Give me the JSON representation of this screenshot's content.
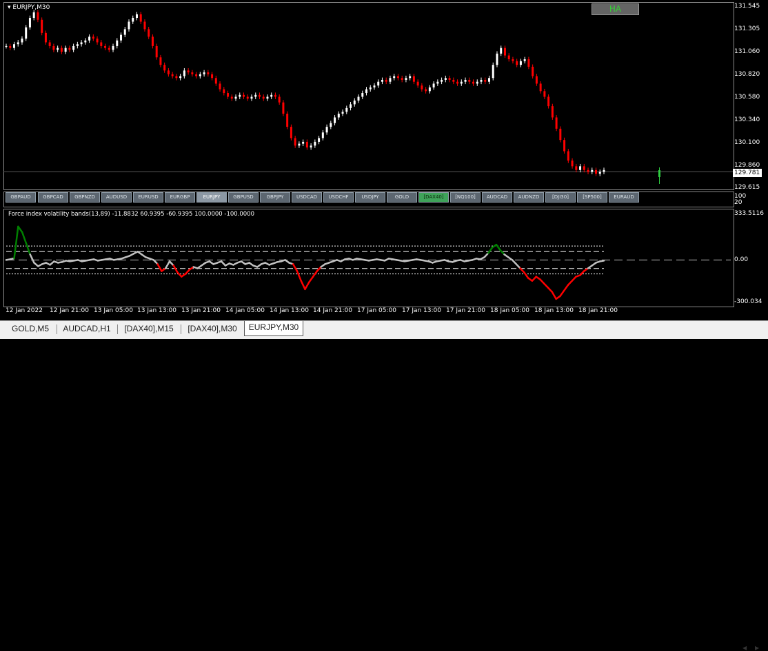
{
  "chart": {
    "title": "EURJPY,M30",
    "indicator_title": "Force index volatility bands(13,89) -11.8832 60.9395 -60.9395 100.0000 -100.0000",
    "ha_label": "HA",
    "price_axis": [
      "131.545",
      "131.305",
      "131.060",
      "130.820",
      "130.580",
      "130.340",
      "130.100",
      "129.860",
      "129.615"
    ],
    "current_price": "129.781",
    "mid_axis": [
      "100",
      "20"
    ],
    "ind_axis": [
      "333.5116",
      "0.00",
      "-300.034"
    ],
    "time_axis": [
      "12 Jan 2022",
      "12 Jan 21:00",
      "13 Jan 05:00",
      "13 Jan 13:00",
      "13 Jan 21:00",
      "14 Jan 05:00",
      "14 Jan 13:00",
      "14 Jan 21:00",
      "17 Jan 05:00",
      "17 Jan 13:00",
      "17 Jan 21:00",
      "18 Jan 05:00",
      "18 Jan 13:00",
      "18 Jan 21:00"
    ],
    "colors": {
      "bull": "#ffffff",
      "bear": "#ff0000",
      "grid": "#8c8c8c",
      "band": "#ffffff",
      "line": "#c0c0c0",
      "up_signal": "#008000",
      "down_signal": "#ff0000"
    }
  },
  "symbol_buttons": [
    {
      "label": "GBPAUD",
      "style": ""
    },
    {
      "label": "GBPCAD",
      "style": ""
    },
    {
      "label": "GBPNZD",
      "style": ""
    },
    {
      "label": "AUDUSD",
      "style": ""
    },
    {
      "label": "EURUSD",
      "style": ""
    },
    {
      "label": "EURGBP",
      "style": ""
    },
    {
      "label": "EURJPY",
      "style": "active"
    },
    {
      "label": "GBPUSD",
      "style": ""
    },
    {
      "label": "GBPJPY",
      "style": ""
    },
    {
      "label": "USDCAD",
      "style": ""
    },
    {
      "label": "USDCHF",
      "style": ""
    },
    {
      "label": "USDJPY",
      "style": ""
    },
    {
      "label": "GOLD",
      "style": ""
    },
    {
      "label": "[DAX40]",
      "style": "green"
    },
    {
      "label": "[NQ100]",
      "style": ""
    },
    {
      "label": "AUDCAD",
      "style": ""
    },
    {
      "label": "AUDNZD",
      "style": ""
    },
    {
      "label": "[DJI30]",
      "style": ""
    },
    {
      "label": "[SP500]",
      "style": ""
    },
    {
      "label": "EURAUD",
      "style": ""
    }
  ],
  "tabs": [
    {
      "label": "GOLD,M5",
      "active": false
    },
    {
      "label": "AUDCAD,H1",
      "active": false
    },
    {
      "label": "[DAX40],M15",
      "active": false
    },
    {
      "label": "[DAX40],M30",
      "active": false
    },
    {
      "label": "EURJPY,M30",
      "active": true
    }
  ],
  "price_series": [
    131.12,
    131.1,
    131.14,
    131.16,
    131.2,
    131.32,
    131.42,
    131.48,
    131.4,
    131.26,
    131.16,
    131.12,
    131.08,
    131.1,
    131.06,
    131.1,
    131.08,
    131.12,
    131.14,
    131.16,
    131.18,
    131.22,
    131.2,
    131.16,
    131.12,
    131.1,
    131.08,
    131.12,
    131.18,
    131.24,
    131.3,
    131.38,
    131.42,
    131.46,
    131.38,
    131.3,
    131.22,
    131.12,
    131.0,
    130.92,
    130.86,
    130.82,
    130.8,
    130.78,
    130.8,
    130.86,
    130.84,
    130.82,
    130.8,
    130.82,
    130.84,
    130.82,
    130.78,
    130.72,
    130.66,
    130.62,
    130.58,
    130.56,
    130.58,
    130.6,
    130.58,
    130.56,
    130.58,
    130.6,
    130.58,
    130.56,
    130.58,
    130.6,
    130.58,
    130.52,
    130.4,
    130.26,
    130.14,
    130.06,
    130.08,
    130.1,
    130.04,
    130.06,
    130.1,
    130.14,
    130.2,
    130.26,
    130.3,
    130.36,
    130.4,
    130.42,
    130.46,
    130.5,
    130.54,
    130.58,
    130.62,
    130.66,
    130.68,
    130.7,
    130.74,
    130.76,
    130.74,
    130.78,
    130.8,
    130.78,
    130.76,
    130.78,
    130.8,
    130.74,
    130.7,
    130.66,
    130.64,
    130.68,
    130.72,
    130.74,
    130.76,
    130.78,
    130.76,
    130.74,
    130.72,
    130.74,
    130.76,
    130.74,
    130.72,
    130.74,
    130.76,
    130.74,
    130.78,
    130.92,
    131.04,
    131.1,
    131.02,
    130.98,
    130.96,
    130.92,
    130.96,
    130.98,
    130.9,
    130.8,
    130.72,
    130.64,
    130.58,
    130.48,
    130.36,
    130.24,
    130.12,
    130.0,
    129.9,
    129.84,
    129.8,
    129.84,
    129.8,
    129.78,
    129.8,
    129.76,
    129.78,
    129.8
  ],
  "ind_series": [
    0,
    5,
    12,
    240,
    200,
    120,
    40,
    -20,
    -45,
    -30,
    -20,
    -35,
    -10,
    -20,
    -15,
    -5,
    -10,
    -5,
    0,
    -10,
    -5,
    0,
    5,
    -5,
    0,
    5,
    10,
    0,
    5,
    10,
    20,
    30,
    45,
    60,
    40,
    20,
    10,
    0,
    -30,
    -80,
    -60,
    -10,
    -40,
    -90,
    -120,
    -100,
    -70,
    -50,
    -60,
    -40,
    -20,
    -10,
    -30,
    -20,
    -10,
    -40,
    -25,
    -35,
    -20,
    -10,
    -30,
    -20,
    -40,
    -50,
    -30,
    -20,
    -35,
    -25,
    -15,
    -10,
    0,
    -20,
    -30,
    -80,
    -150,
    -210,
    -160,
    -120,
    -80,
    -50,
    -30,
    -20,
    -10,
    0,
    -10,
    5,
    10,
    0,
    10,
    5,
    0,
    -5,
    0,
    5,
    0,
    -5,
    10,
    5,
    0,
    -5,
    -10,
    -5,
    0,
    5,
    0,
    -5,
    -10,
    -20,
    -10,
    -5,
    0,
    -10,
    -15,
    -5,
    0,
    -10,
    -5,
    0,
    10,
    5,
    20,
    50,
    90,
    110,
    70,
    40,
    20,
    0,
    -30,
    -60,
    -90,
    -130,
    -150,
    -120,
    -140,
    -170,
    -200,
    -230,
    -280,
    -260,
    -220,
    -180,
    -150,
    -120,
    -110,
    -80,
    -60,
    -40,
    -20,
    -10,
    -5
  ]
}
